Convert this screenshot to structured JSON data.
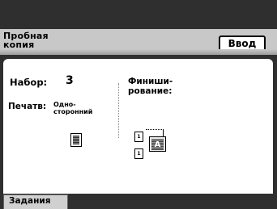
{
  "header": {
    "title_line1": "Пробная",
    "title_line2": "копия",
    "enter_button": "Ввод"
  },
  "settings": {
    "set_label": "Набор:",
    "set_value": "3",
    "print_label": "Печатв:",
    "print_value_line1": "Одно-",
    "print_value_line2": "сторонний",
    "finishing_label_line1": "Финиши-",
    "finishing_label_line2": "рование:"
  },
  "icons": {
    "finish_icon_letter": "A",
    "side_icon_1": "1",
    "side_icon_2": "1"
  },
  "footer": {
    "jobs_tab": "Задания"
  }
}
